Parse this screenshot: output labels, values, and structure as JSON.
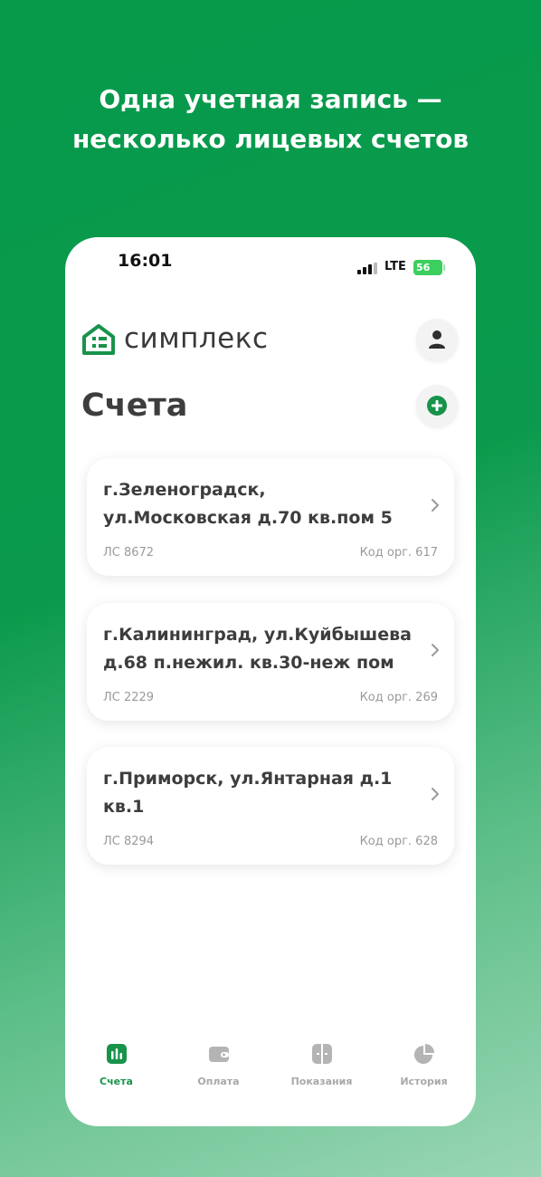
{
  "promo": {
    "line1": "Одна учетная запись —",
    "line2": "несколько лицевых счетов"
  },
  "status_bar": {
    "time": "16:01",
    "network": "LTE",
    "battery": "56"
  },
  "header": {
    "logo_text": "симплекс",
    "profile_icon": "user-icon",
    "add_icon": "plus-icon"
  },
  "page_title": "Счета",
  "accounts": [
    {
      "address_line1": "г.Зеленоградск,",
      "address_line2": "ул.Московская д.70 кв.пом 5",
      "account": "ЛС 8672",
      "org_code": "Код орг. 617"
    },
    {
      "address_line1": "г.Калининград, ул.Куйбышева",
      "address_line2": "д.68 п.нежил. кв.30-неж пом",
      "account": "ЛС 2229",
      "org_code": "Код орг. 269"
    },
    {
      "address_line1": "г.Приморск, ул.Янтарная д.1",
      "address_line2": "кв.1",
      "account": "ЛС 8294",
      "org_code": "Код орг. 628"
    }
  ],
  "tabbar": {
    "tabs": [
      {
        "label": "Счета",
        "icon": "bar-chart-icon",
        "active": true
      },
      {
        "label": "Оплата",
        "icon": "wallet-icon",
        "active": false
      },
      {
        "label": "Показания",
        "icon": "meter-icon",
        "active": false
      },
      {
        "label": "История",
        "icon": "pie-chart-icon",
        "active": false
      }
    ]
  },
  "colors": {
    "brand_green": "#18934a",
    "background_green": "#079a4b",
    "text_dark": "#3d3d3d",
    "text_muted": "#9a9a9a",
    "tab_inactive": "#a8a8a8"
  }
}
